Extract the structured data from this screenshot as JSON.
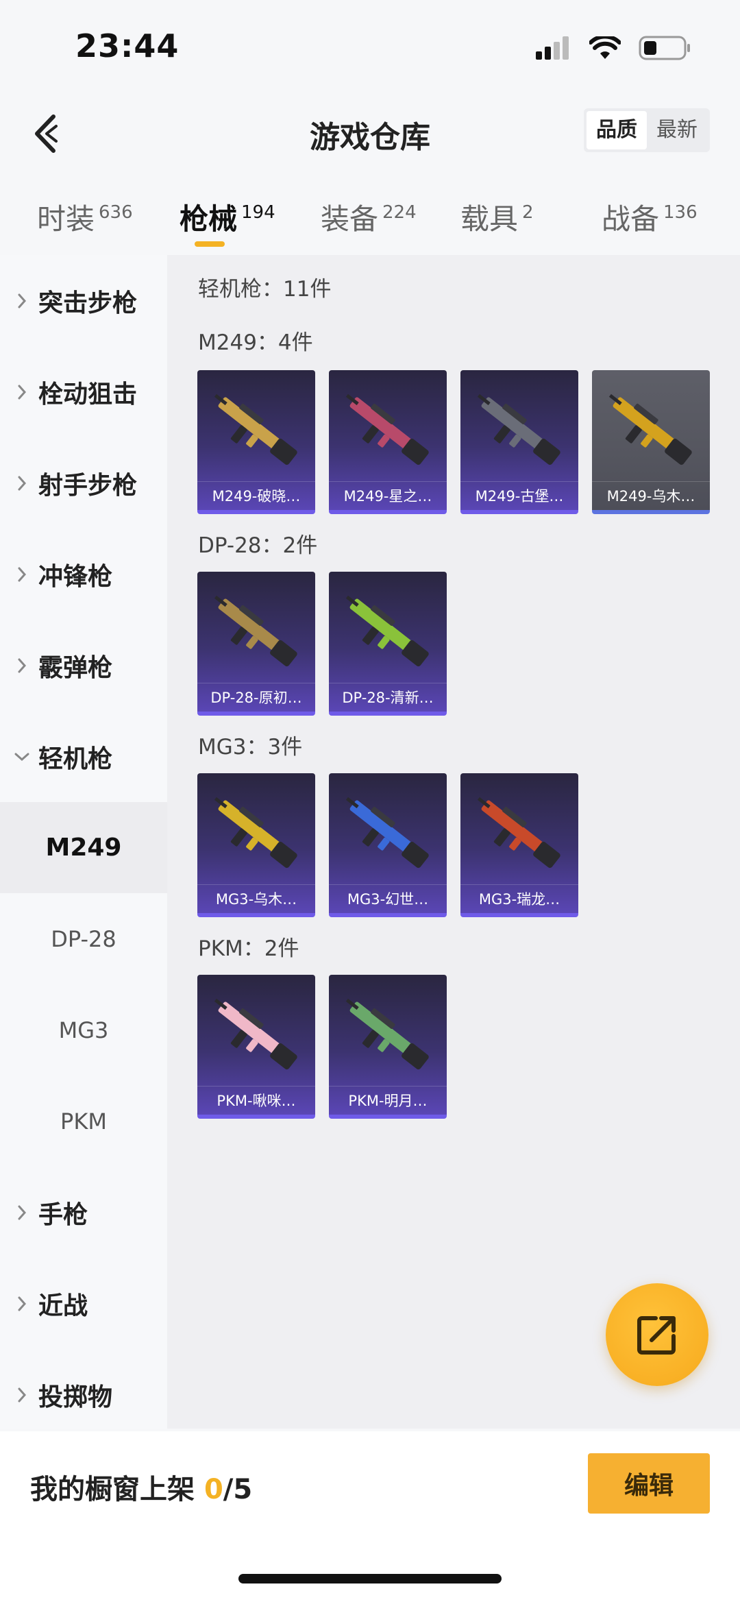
{
  "status_bar": {
    "time": "23:44"
  },
  "header": {
    "title": "游戏仓库",
    "sort_options": [
      "品质",
      "最新"
    ],
    "sort_active": 0
  },
  "tabs": [
    {
      "label": "时装",
      "count": "636"
    },
    {
      "label": "枪械",
      "count": "194"
    },
    {
      "label": "装备",
      "count": "224"
    },
    {
      "label": "载具",
      "count": "2"
    },
    {
      "label": "战备",
      "count": "136"
    }
  ],
  "active_tab": 1,
  "sidebar": {
    "categories": [
      "突击步枪",
      "栓动狙击",
      "射手步枪",
      "冲锋枪",
      "霰弹枪",
      "轻机枪",
      "手枪",
      "近战",
      "投掷物"
    ],
    "expanded_category": "轻机枪",
    "subcategories": [
      "M249",
      "DP-28",
      "MG3",
      "PKM"
    ],
    "active_subcategory": "M249"
  },
  "content": {
    "summary": "轻机枪：11件",
    "groups": [
      {
        "title": "M249：4件",
        "items": [
          {
            "label": "M249-破晓…",
            "accent": "#c9a24a",
            "bg": "purple"
          },
          {
            "label": "M249-星之…",
            "accent": "#b84a6a",
            "bg": "purple"
          },
          {
            "label": "M249-古堡…",
            "accent": "#6a6d78",
            "bg": "purple"
          },
          {
            "label": "M249-乌木…",
            "accent": "#d4a21e",
            "bg": "grey"
          }
        ]
      },
      {
        "title": "DP-28：2件",
        "items": [
          {
            "label": "DP-28-原初…",
            "accent": "#a88a4a",
            "bg": "purple"
          },
          {
            "label": "DP-28-清新…",
            "accent": "#8ac23a",
            "bg": "purple"
          }
        ]
      },
      {
        "title": "MG3：3件",
        "items": [
          {
            "label": "MG3-乌木…",
            "accent": "#d6b22a",
            "bg": "purple"
          },
          {
            "label": "MG3-幻世…",
            "accent": "#3a6ad8",
            "bg": "purple"
          },
          {
            "label": "MG3-瑞龙…",
            "accent": "#c84a2a",
            "bg": "purple"
          }
        ]
      },
      {
        "title": "PKM：2件",
        "items": [
          {
            "label": "PKM-啾咪…",
            "accent": "#f0b8c8",
            "bg": "purple"
          },
          {
            "label": "PKM-明月…",
            "accent": "#6aa86a",
            "bg": "purple"
          }
        ]
      }
    ]
  },
  "bottom": {
    "showcase_label": "我的橱窗上架",
    "showcase_count": "0",
    "showcase_total": "/5",
    "edit_label": "编辑"
  },
  "colors": {
    "accent": "#f4b224",
    "card_border": "#6f5be8"
  }
}
